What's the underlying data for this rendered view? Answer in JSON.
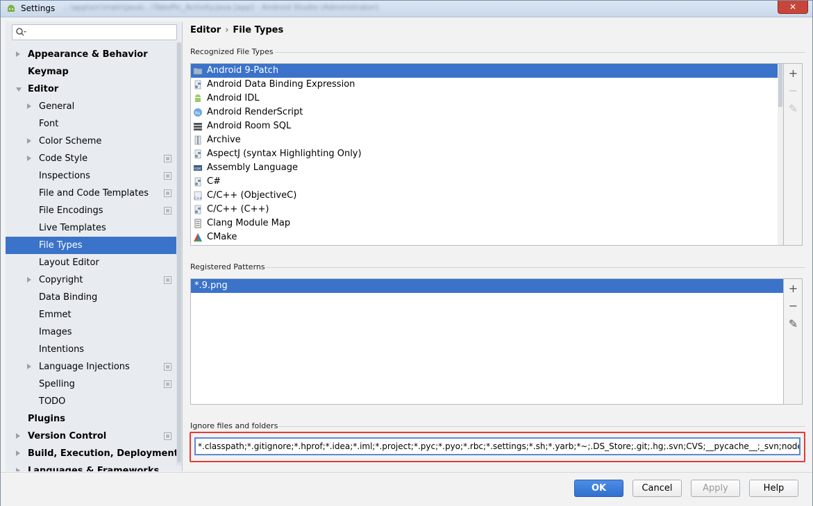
{
  "window": {
    "title": "Settings",
    "title_obscured": "...\\app\\src\\main\\java\\...\\TakePic_Activity.java [app] - Android Studio (Administrator)",
    "close_label": "✕"
  },
  "search": {
    "placeholder": ""
  },
  "sidebar": {
    "items": [
      {
        "label": "Appearance & Behavior",
        "bold": true,
        "level": 0,
        "arrow": "right"
      },
      {
        "label": "Keymap",
        "bold": true,
        "level": 0,
        "arrow": ""
      },
      {
        "label": "Editor",
        "bold": true,
        "level": 0,
        "arrow": "down"
      },
      {
        "label": "General",
        "level": 1,
        "arrow": "right"
      },
      {
        "label": "Font",
        "level": 1,
        "arrow": ""
      },
      {
        "label": "Color Scheme",
        "level": 1,
        "arrow": "right"
      },
      {
        "label": "Code Style",
        "level": 1,
        "arrow": "right",
        "project": true
      },
      {
        "label": "Inspections",
        "level": 1,
        "arrow": "",
        "project": true
      },
      {
        "label": "File and Code Templates",
        "level": 1,
        "arrow": "",
        "project": true
      },
      {
        "label": "File Encodings",
        "level": 1,
        "arrow": "",
        "project": true
      },
      {
        "label": "Live Templates",
        "level": 1,
        "arrow": ""
      },
      {
        "label": "File Types",
        "level": 1,
        "arrow": "",
        "selected": true
      },
      {
        "label": "Layout Editor",
        "level": 1,
        "arrow": ""
      },
      {
        "label": "Copyright",
        "level": 1,
        "arrow": "right",
        "project": true
      },
      {
        "label": "Data Binding",
        "level": 1,
        "arrow": ""
      },
      {
        "label": "Emmet",
        "level": 1,
        "arrow": ""
      },
      {
        "label": "Images",
        "level": 1,
        "arrow": ""
      },
      {
        "label": "Intentions",
        "level": 1,
        "arrow": ""
      },
      {
        "label": "Language Injections",
        "level": 1,
        "arrow": "right",
        "project": true
      },
      {
        "label": "Spelling",
        "level": 1,
        "arrow": "",
        "project": true
      },
      {
        "label": "TODO",
        "level": 1,
        "arrow": ""
      },
      {
        "label": "Plugins",
        "bold": true,
        "level": 0,
        "arrow": ""
      },
      {
        "label": "Version Control",
        "bold": true,
        "level": 0,
        "arrow": "right",
        "project": true
      },
      {
        "label": "Build, Execution, Deployment",
        "bold": true,
        "level": 0,
        "arrow": "right"
      },
      {
        "label": "Languages & Frameworks",
        "bold": true,
        "level": 0,
        "arrow": "right"
      }
    ]
  },
  "breadcrumb": {
    "parent": "Editor",
    "separator": "›",
    "current": "File Types"
  },
  "recognized": {
    "label": "Recognized File Types",
    "items": [
      {
        "label": "Android 9-Patch",
        "icon": "folder-icon",
        "selected": true
      },
      {
        "label": "Android Data Binding Expression",
        "icon": "generic-file-icon"
      },
      {
        "label": "Android IDL",
        "icon": "android-icon"
      },
      {
        "label": "Android RenderScript",
        "icon": "renderscript-icon"
      },
      {
        "label": "Android Room SQL",
        "icon": "database-icon"
      },
      {
        "label": "Archive",
        "icon": "archive-icon"
      },
      {
        "label": "AspectJ (syntax Highlighting Only)",
        "icon": "generic-file-icon"
      },
      {
        "label": "Assembly Language",
        "icon": "asm-icon"
      },
      {
        "label": "C#",
        "icon": "generic-file-icon"
      },
      {
        "label": "C/C++ (ObjectiveC)",
        "icon": "cpp-icon"
      },
      {
        "label": "C/C++ (C++)",
        "icon": "generic-file-icon"
      },
      {
        "label": "Clang Module Map",
        "icon": "text-file-icon"
      },
      {
        "label": "CMake",
        "icon": "cmake-icon"
      }
    ],
    "tools": {
      "add": "+",
      "remove": "−",
      "edit": "✎"
    }
  },
  "patterns": {
    "label": "Registered Patterns",
    "items": [
      {
        "label": "*.9.png",
        "selected": true
      }
    ],
    "tools": {
      "add": "+",
      "remove": "−",
      "edit": "✎"
    }
  },
  "ignore": {
    "label": "Ignore files and folders",
    "value": "*.classpath;*.gitignore;*.hprof;*.idea;*.iml;*.project;*.pyc;*.pyo;*.rbc;*.settings;*.sh;*.yarb;*~;.DS_Store;.git;.hg;.svn;CVS;__pycache__;_svn;node_modules;vs"
  },
  "footer": {
    "ok": "OK",
    "cancel": "Cancel",
    "apply": "Apply",
    "help": "Help"
  },
  "colors": {
    "selection": "#3a73c9",
    "highlight_border": "#e53935",
    "primary_button": "#2f6fcf"
  }
}
